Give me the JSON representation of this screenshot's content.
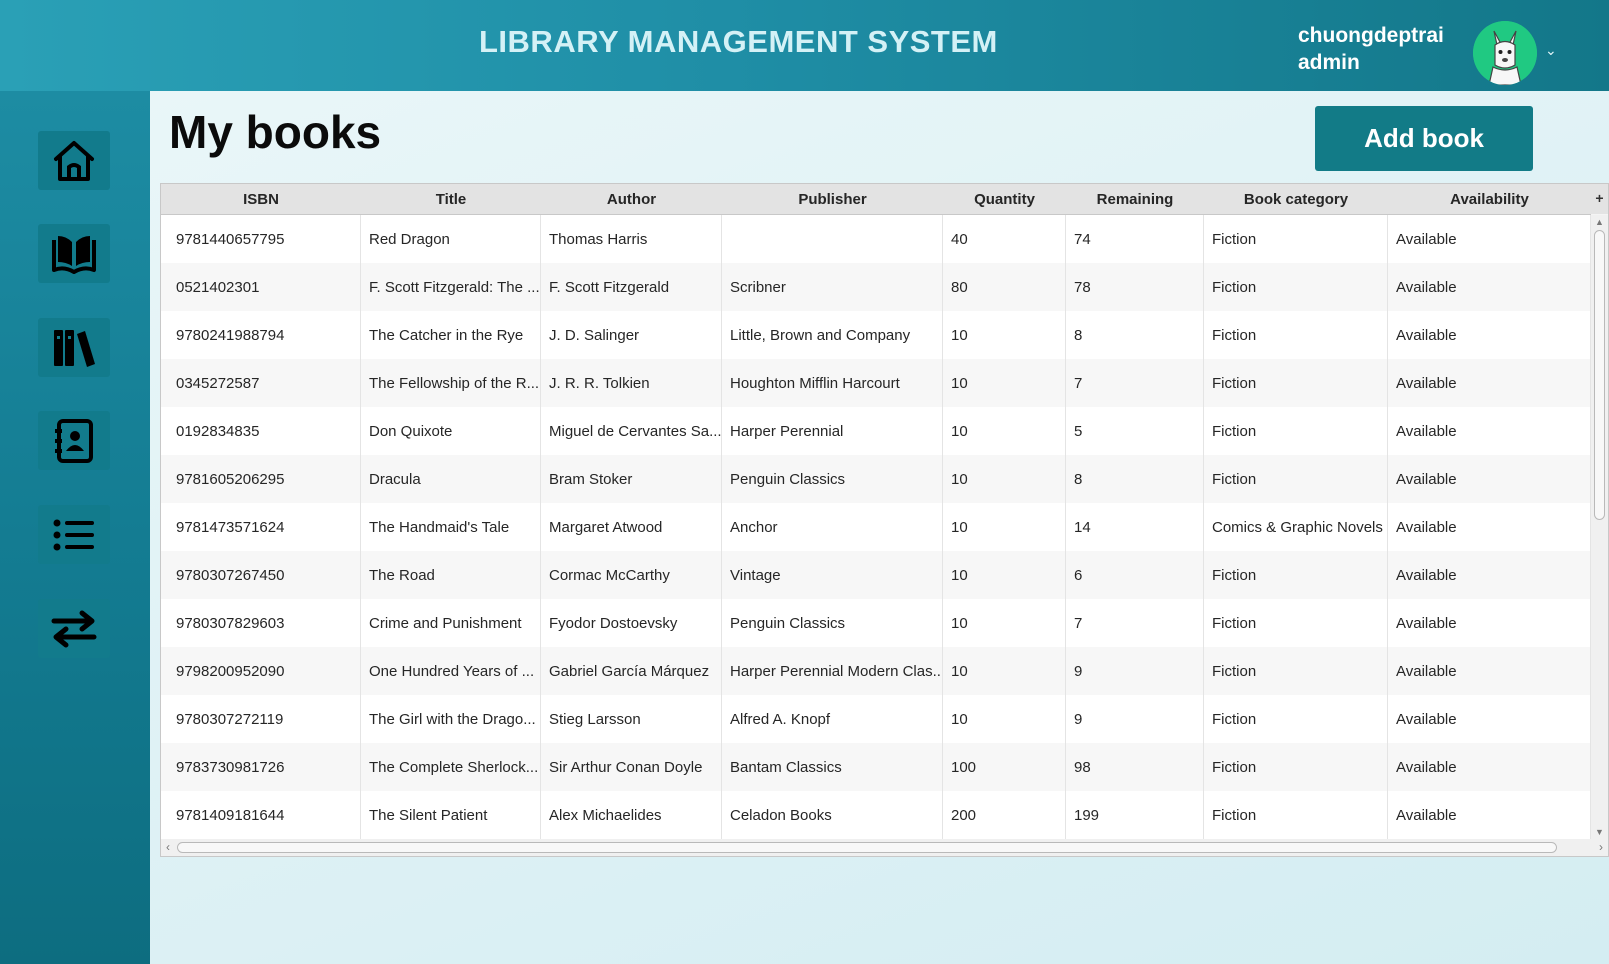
{
  "header": {
    "app_title": "LIBRARY MANAGEMENT SYSTEM",
    "user_name": "chuongdeptrai",
    "user_role": "admin",
    "dropdown_icon": "chevron-down-icon"
  },
  "sidebar": {
    "items": [
      {
        "icon": "home-icon"
      },
      {
        "icon": "open-book-icon"
      },
      {
        "icon": "bookshelf-icon"
      },
      {
        "icon": "contact-book-icon"
      },
      {
        "icon": "list-icon"
      },
      {
        "icon": "transfer-arrows-icon"
      }
    ]
  },
  "main": {
    "page_title": "My books",
    "add_book_label": "Add book",
    "corner_label": "+"
  },
  "table": {
    "columns": [
      "ISBN",
      "Title",
      "Author",
      "Publisher",
      "Quantity",
      "Remaining",
      "Book category",
      "Availability"
    ],
    "rows": [
      [
        "9781440657795",
        "Red Dragon",
        "Thomas Harris",
        "",
        "40",
        "74",
        "Fiction",
        "Available"
      ],
      [
        "0521402301",
        "F. Scott Fitzgerald: The ...",
        "F. Scott Fitzgerald",
        "Scribner",
        "80",
        "78",
        "Fiction",
        "Available"
      ],
      [
        "9780241988794",
        "The Catcher in the Rye",
        "J. D. Salinger",
        "Little, Brown and Company",
        "10",
        "8",
        "Fiction",
        "Available"
      ],
      [
        "0345272587",
        "The Fellowship of the R...",
        "J. R. R. Tolkien",
        "Houghton Mifflin Harcourt",
        "10",
        "7",
        "Fiction",
        "Available"
      ],
      [
        "0192834835",
        "Don Quixote",
        "Miguel de Cervantes Sa...",
        "Harper Perennial",
        "10",
        "5",
        "Fiction",
        "Available"
      ],
      [
        "9781605206295",
        "Dracula",
        "Bram Stoker",
        "Penguin Classics",
        "10",
        "8",
        "Fiction",
        "Available"
      ],
      [
        "9781473571624",
        "The Handmaid's Tale",
        "Margaret Atwood",
        "Anchor",
        "10",
        "14",
        "Comics & Graphic Novels",
        "Available"
      ],
      [
        "9780307267450",
        "The Road",
        "Cormac McCarthy",
        "Vintage",
        "10",
        "6",
        "Fiction",
        "Available"
      ],
      [
        "9780307829603",
        "Crime and Punishment",
        "Fyodor Dostoevsky",
        "Penguin Classics",
        "10",
        "7",
        "Fiction",
        "Available"
      ],
      [
        "9798200952090",
        "One Hundred Years of ...",
        "Gabriel García Márquez",
        "Harper Perennial Modern Clas...",
        "10",
        "9",
        "Fiction",
        "Available"
      ],
      [
        "9780307272119",
        "The Girl with the Drago...",
        "Stieg Larsson",
        "Alfred A. Knopf",
        "10",
        "9",
        "Fiction",
        "Available"
      ],
      [
        "9783730981726",
        "The Complete Sherlock...",
        "Sir Arthur Conan Doyle",
        "Bantam Classics",
        "100",
        "98",
        "Fiction",
        "Available"
      ],
      [
        "9781409181644",
        "The Silent Patient",
        "Alex Michaelides",
        "Celadon Books",
        "200",
        "199",
        "Fiction",
        "Available"
      ]
    ]
  },
  "colors": {
    "header_start": "#2aa0b6",
    "header_end": "#137789",
    "sidebar": "#137b91",
    "nav_button": "#127b8c",
    "add_button": "#127b87",
    "avatar_bg": "#20c982"
  }
}
